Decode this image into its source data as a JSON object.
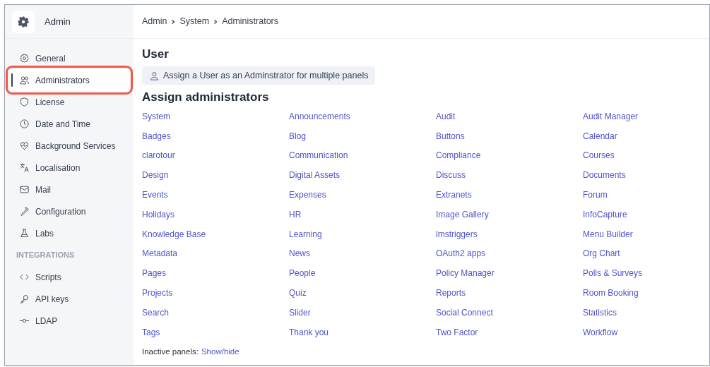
{
  "app": {
    "title": "Admin"
  },
  "sidebar": {
    "sections": [
      {
        "items": [
          {
            "label": "General",
            "selected": false
          },
          {
            "label": "Administrators",
            "selected": true
          },
          {
            "label": "License",
            "selected": false
          },
          {
            "label": "Date and Time",
            "selected": false
          },
          {
            "label": "Background Services",
            "selected": false
          },
          {
            "label": "Localisation",
            "selected": false
          },
          {
            "label": "Mail",
            "selected": false
          },
          {
            "label": "Configuration",
            "selected": false
          },
          {
            "label": "Labs",
            "selected": false
          }
        ]
      },
      {
        "heading": "INTEGRATIONS",
        "items": [
          {
            "label": "Scripts",
            "selected": false
          },
          {
            "label": "API keys",
            "selected": false
          },
          {
            "label": "LDAP",
            "selected": false
          }
        ]
      }
    ]
  },
  "breadcrumb": [
    "Admin",
    "System",
    "Administrators"
  ],
  "user_section": {
    "heading": "User",
    "button": "Assign a User as an Adminstrator for multiple panels"
  },
  "assign_section": {
    "heading": "Assign administrators",
    "panels": [
      "System",
      "Announcements",
      "Audit",
      "Audit Manager",
      "Badges",
      "Blog",
      "Buttons",
      "Calendar",
      "clarotour",
      "Communication",
      "Compliance",
      "Courses",
      "Design",
      "Digital Assets",
      "Discuss",
      "Documents",
      "Events",
      "Expenses",
      "Extranets",
      "Forum",
      "Holidays",
      "HR",
      "Image Gallery",
      "InfoCapture",
      "Knowledge Base",
      "Learning",
      "lmstriggers",
      "Menu Builder",
      "Metadata",
      "News",
      "OAuth2 apps",
      "Org Chart",
      "Pages",
      "People",
      "Policy Manager",
      "Polls & Surveys",
      "Projects",
      "Quiz",
      "Reports",
      "Room Booking",
      "Search",
      "Slider",
      "Social Connect",
      "Statistics",
      "Tags",
      "Thank you",
      "Two Factor",
      "Workflow"
    ]
  },
  "footer": {
    "label": "Inactive panels:",
    "link": "Show/hide"
  }
}
